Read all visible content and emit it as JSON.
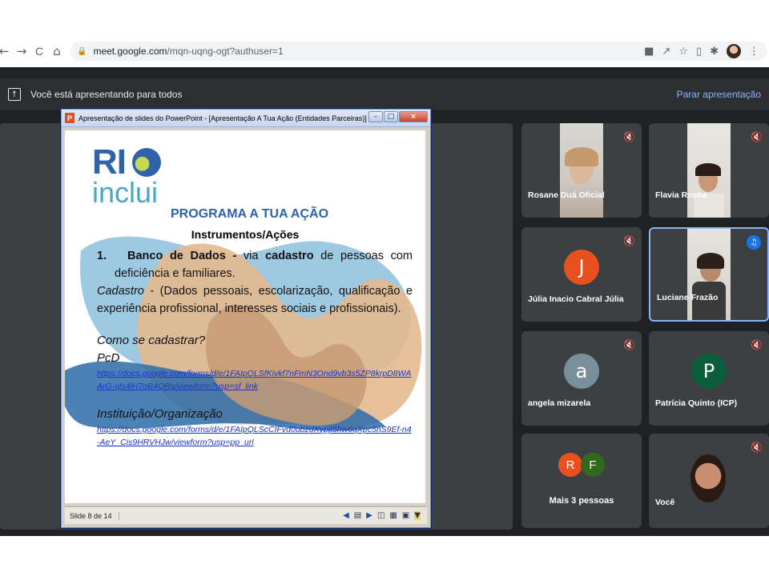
{
  "browser": {
    "back": "←",
    "forward": "→",
    "reload": "C",
    "home": "⌂",
    "url_host": "meet.google.com",
    "url_path": "/mqn-uqng-ogt?authuser=1",
    "icons": [
      "camera-icon",
      "share-icon",
      "star-icon",
      "extension-icon",
      "puzzle-icon",
      "profile-avatar"
    ]
  },
  "meet": {
    "presenting_text": "Você está apresentando para todos",
    "stop_presenting": "Parar apresentação"
  },
  "ppt": {
    "window_title": "Apresentação de slides do PowerPoint - [Apresentação A Tua Ação (Entidades Parceiras)] - ...",
    "logo_rio": "RI",
    "logo_inclui": "inclui",
    "title": "PROGRAMA A TUA AÇÃO",
    "subtitle": "Instrumentos/Ações",
    "item1_num": "1.",
    "item1_bold": "Banco de Dados -",
    "item1_text_a": " via ",
    "item1_bold2": "cadastro",
    "item1_text_b": " de pessoas com deficiência e familiares.",
    "cadastro_label": "Cadastro",
    "cadastro_text": " - (Dados pessoais, escolarização, qualificação e experiência profissional,  interesses sociais e profissionais).",
    "como": "Como se cadastrar?",
    "pcd": "PcD",
    "link_pcd": "https://docs.google.com/forms/d/e/1FAIpQLSfKivkf7nFmN3Ond9vb3s5ZP8krpD8WAArG-qls4lH7oB4QRg/viewform?usp=sf_link",
    "instituicao": "Instituição/Organização",
    "link_inst": "https://docs.google.com/forms/d/e/1FAIpQLScCIFvd0ubzdXvpjt5hw6qXpc5nS9Ef-n4-AeY_Cis9HRVHJw/viewform?usp=pp_url",
    "status": "Slide 8 de 14"
  },
  "participants": [
    {
      "name": "Rosane Duá Oficial",
      "muted": true,
      "type": "video"
    },
    {
      "name": "Flavia Rocha",
      "muted": true,
      "type": "video"
    },
    {
      "name": "Júlia Inacio Cabral Júlia",
      "muted": true,
      "type": "avatar",
      "initial": "J",
      "color": "#e8501f"
    },
    {
      "name": "Luciane Frazão",
      "speaking": true,
      "type": "video"
    },
    {
      "name": "angela mizarela",
      "muted": true,
      "type": "avatar",
      "initial": "a",
      "color": "#78909c"
    },
    {
      "name": "Patrícia Quinto (ICP)",
      "muted": true,
      "type": "avatar",
      "initial": "P",
      "color": "#0b5e3c"
    },
    {
      "name": "Mais 3 pessoas",
      "type": "more",
      "initials": [
        "R",
        "F"
      ],
      "colors": [
        "#e8501f",
        "#33691e"
      ]
    },
    {
      "name": "Você",
      "muted": true,
      "type": "video"
    }
  ],
  "colors": {
    "meet_bg": "#202124",
    "tile_bg": "#3c4043",
    "link_blue": "#8ab4f8",
    "slide_title_blue": "#2f62a8"
  }
}
